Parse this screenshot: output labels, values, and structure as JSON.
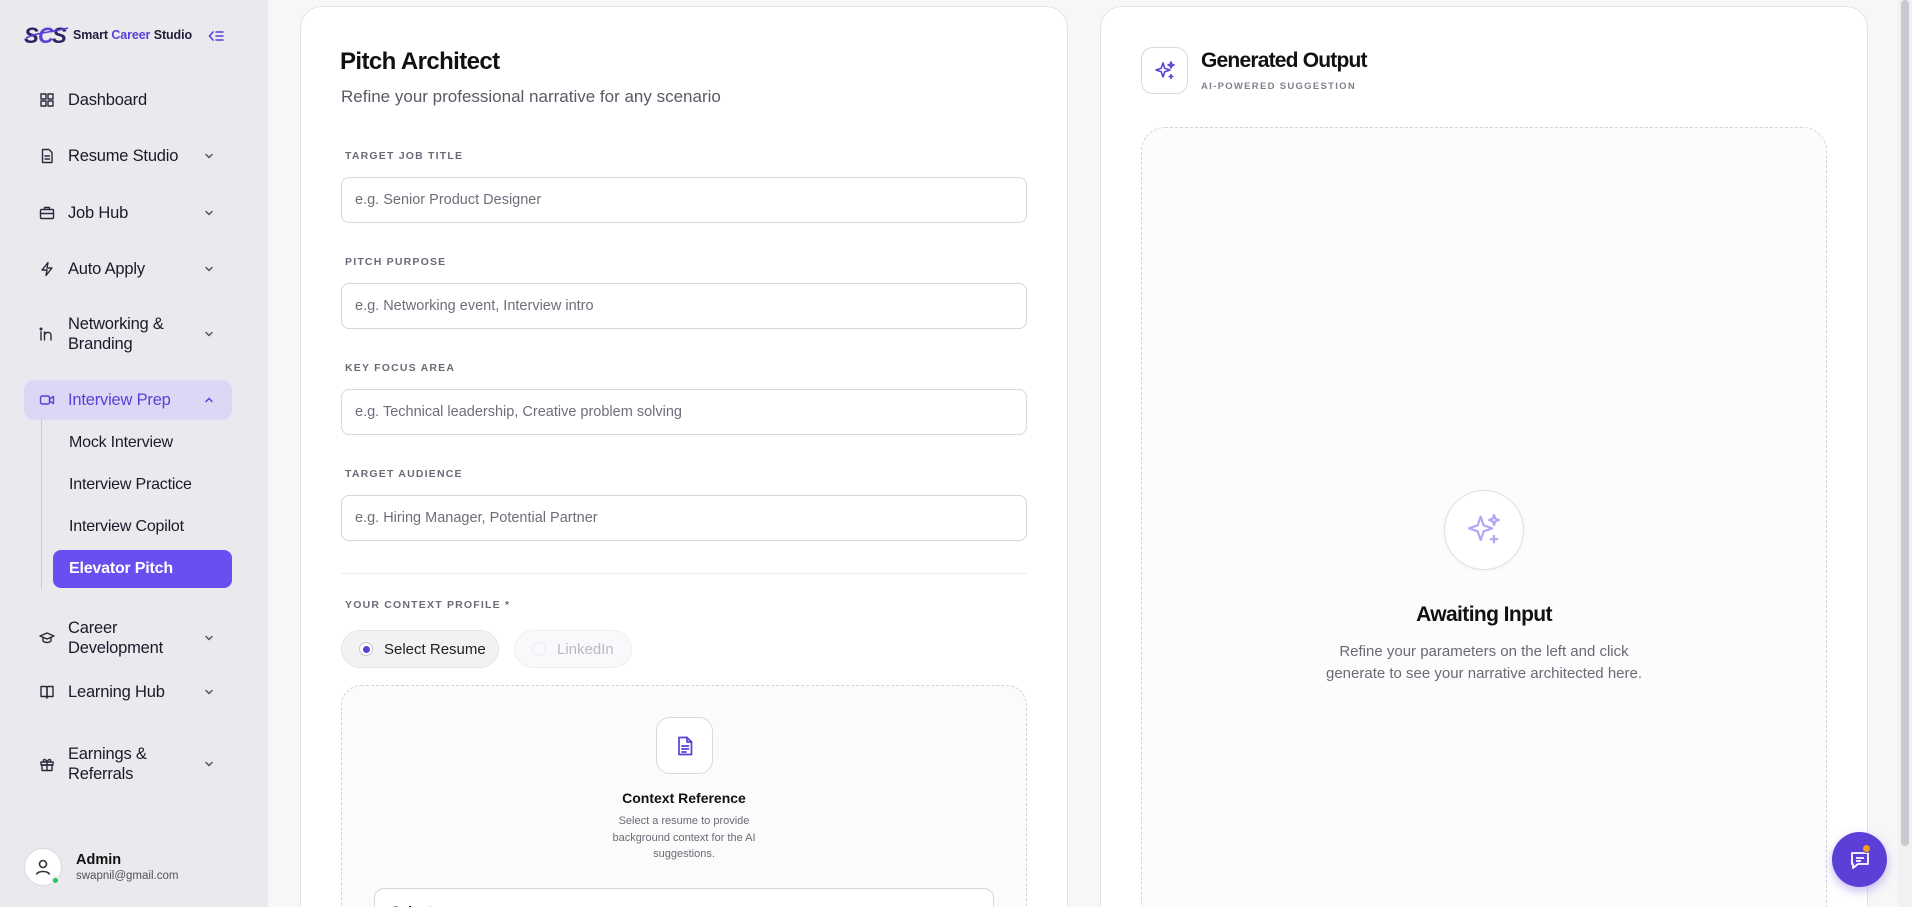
{
  "brand": {
    "name_prefix": "Smart ",
    "name_accent": "Career",
    "name_suffix": " Studio",
    "accent_color": "#5b3fd6"
  },
  "sidebar": {
    "items": [
      {
        "label": "Dashboard",
        "icon": "dashboard-icon",
        "expandable": false
      },
      {
        "label": "Resume Studio",
        "icon": "document-icon",
        "expandable": true
      },
      {
        "label": "Job Hub",
        "icon": "briefcase-icon",
        "expandable": true
      },
      {
        "label": "Auto Apply",
        "icon": "lightning-icon",
        "expandable": true
      },
      {
        "label": "Networking &",
        "label2": "Branding",
        "icon": "linkedin-icon",
        "expandable": true
      },
      {
        "label": "Interview Prep",
        "icon": "video-icon",
        "expandable": true,
        "active": true
      },
      {
        "label": "Career",
        "label2": "Development",
        "icon": "graduation-cap-icon",
        "expandable": true
      },
      {
        "label": "Learning Hub",
        "icon": "book-icon",
        "expandable": true
      },
      {
        "label": "Earnings &",
        "label2": "Referrals",
        "icon": "gift-icon",
        "expandable": true
      }
    ],
    "sub_items": [
      "Mock Interview",
      "Interview Practice",
      "Interview Copilot",
      "Elevator Pitch"
    ],
    "selected_sub_item": "Elevator Pitch"
  },
  "user": {
    "name": "Admin",
    "email": "swapnil@gmail.com",
    "status_color": "#22c55e"
  },
  "form": {
    "title": "Pitch Architect",
    "subtitle": "Refine your professional narrative for any scenario",
    "fields": [
      {
        "label": "TARGET JOB TITLE",
        "placeholder": "e.g. Senior Product Designer",
        "value": ""
      },
      {
        "label": "PITCH PURPOSE",
        "placeholder": "e.g. Networking event, Interview intro",
        "value": ""
      },
      {
        "label": "KEY FOCUS AREA",
        "placeholder": "e.g. Technical leadership, Creative problem solving",
        "value": ""
      },
      {
        "label": "TARGET AUDIENCE",
        "placeholder": "e.g. Hiring Manager, Potential Partner",
        "value": ""
      }
    ],
    "context_label": "YOUR CONTEXT PROFILE *",
    "context_options": [
      "Select Resume",
      "LinkedIn"
    ],
    "selected_context": "Select Resume",
    "context_ref_title": "Context Reference",
    "context_ref_desc": "Select a resume to provide background context for the AI suggestions.",
    "select_text": "Select"
  },
  "output": {
    "title": "Generated Output",
    "subtitle": "AI-POWERED SUGGESTION",
    "empty_title": "Awaiting Input",
    "empty_desc": "Refine your parameters on the left and click generate to see your narrative architected here."
  }
}
